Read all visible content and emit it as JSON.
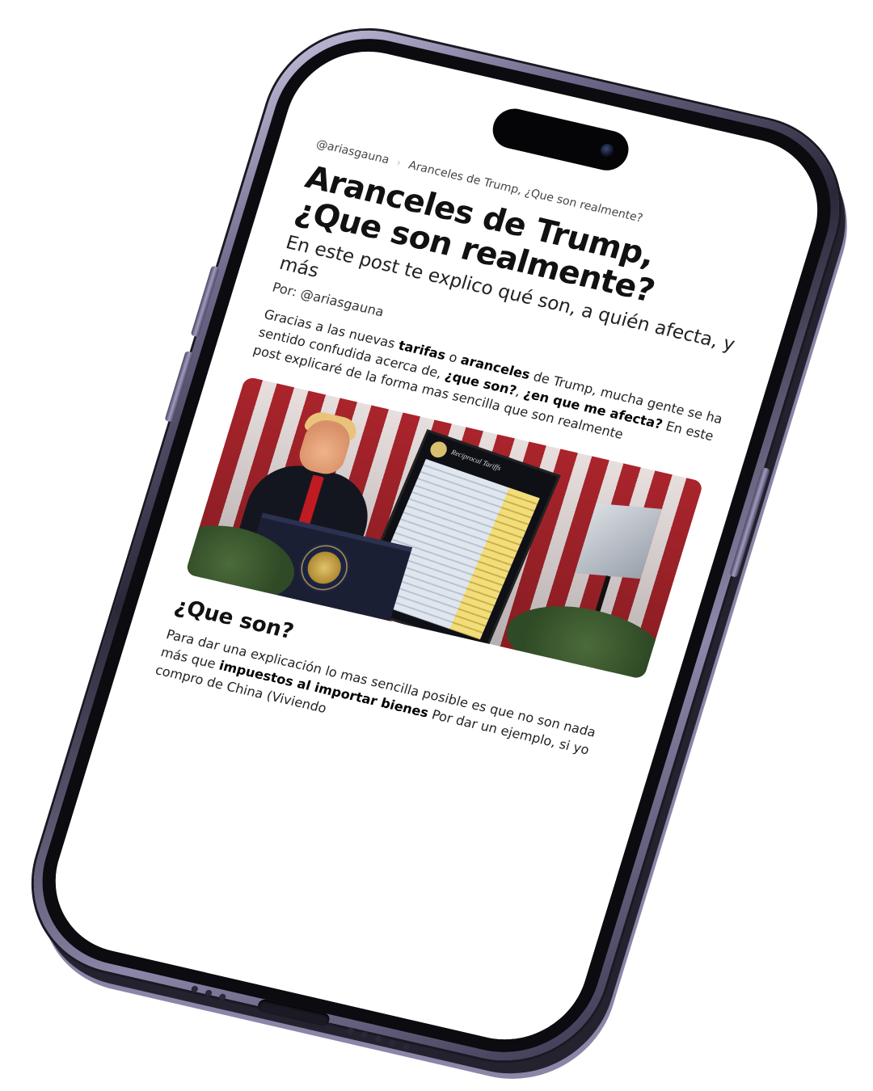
{
  "article": {
    "breadcrumb": {
      "handle": "@ariasgauna",
      "separator": "›",
      "page": "Aranceles de Trump, ¿Que son realmente?"
    },
    "title_line1": "Aranceles de Trump,",
    "title_line2": "¿Que son realmente?",
    "subtitle": "En este post te explico qué son, a quién afecta, y más",
    "author": "Por: @ariasgauna",
    "intro": {
      "t1": "Gracias a las nuevas ",
      "b1": "tarifas",
      "t2": " o ",
      "b2": "aranceles",
      "t3": " de Trump, mucha gente se ha sentido confudida acerca de, ",
      "b3": "¿que son?",
      "t4": ", ",
      "b4": "¿en que me afecta?",
      "t5": " En este post explicaré de la forma mas sencilla que son realmente"
    },
    "hero_image": {
      "board_title": "Reciprocal Tariffs"
    },
    "section_heading": "¿Que son?",
    "section_body": {
      "t1": "Para dar una explicación lo mas sencilla posible es que no son nada más que ",
      "b1": "impuestos al importar bienes",
      "t2": " Por dar un ejemplo, si yo compro de China (Viviendo"
    }
  },
  "colors": {
    "frame": "#6f6a8c",
    "screen": "#ffffff",
    "text": "#1d1d1f",
    "flag_red": "#b3262e"
  }
}
